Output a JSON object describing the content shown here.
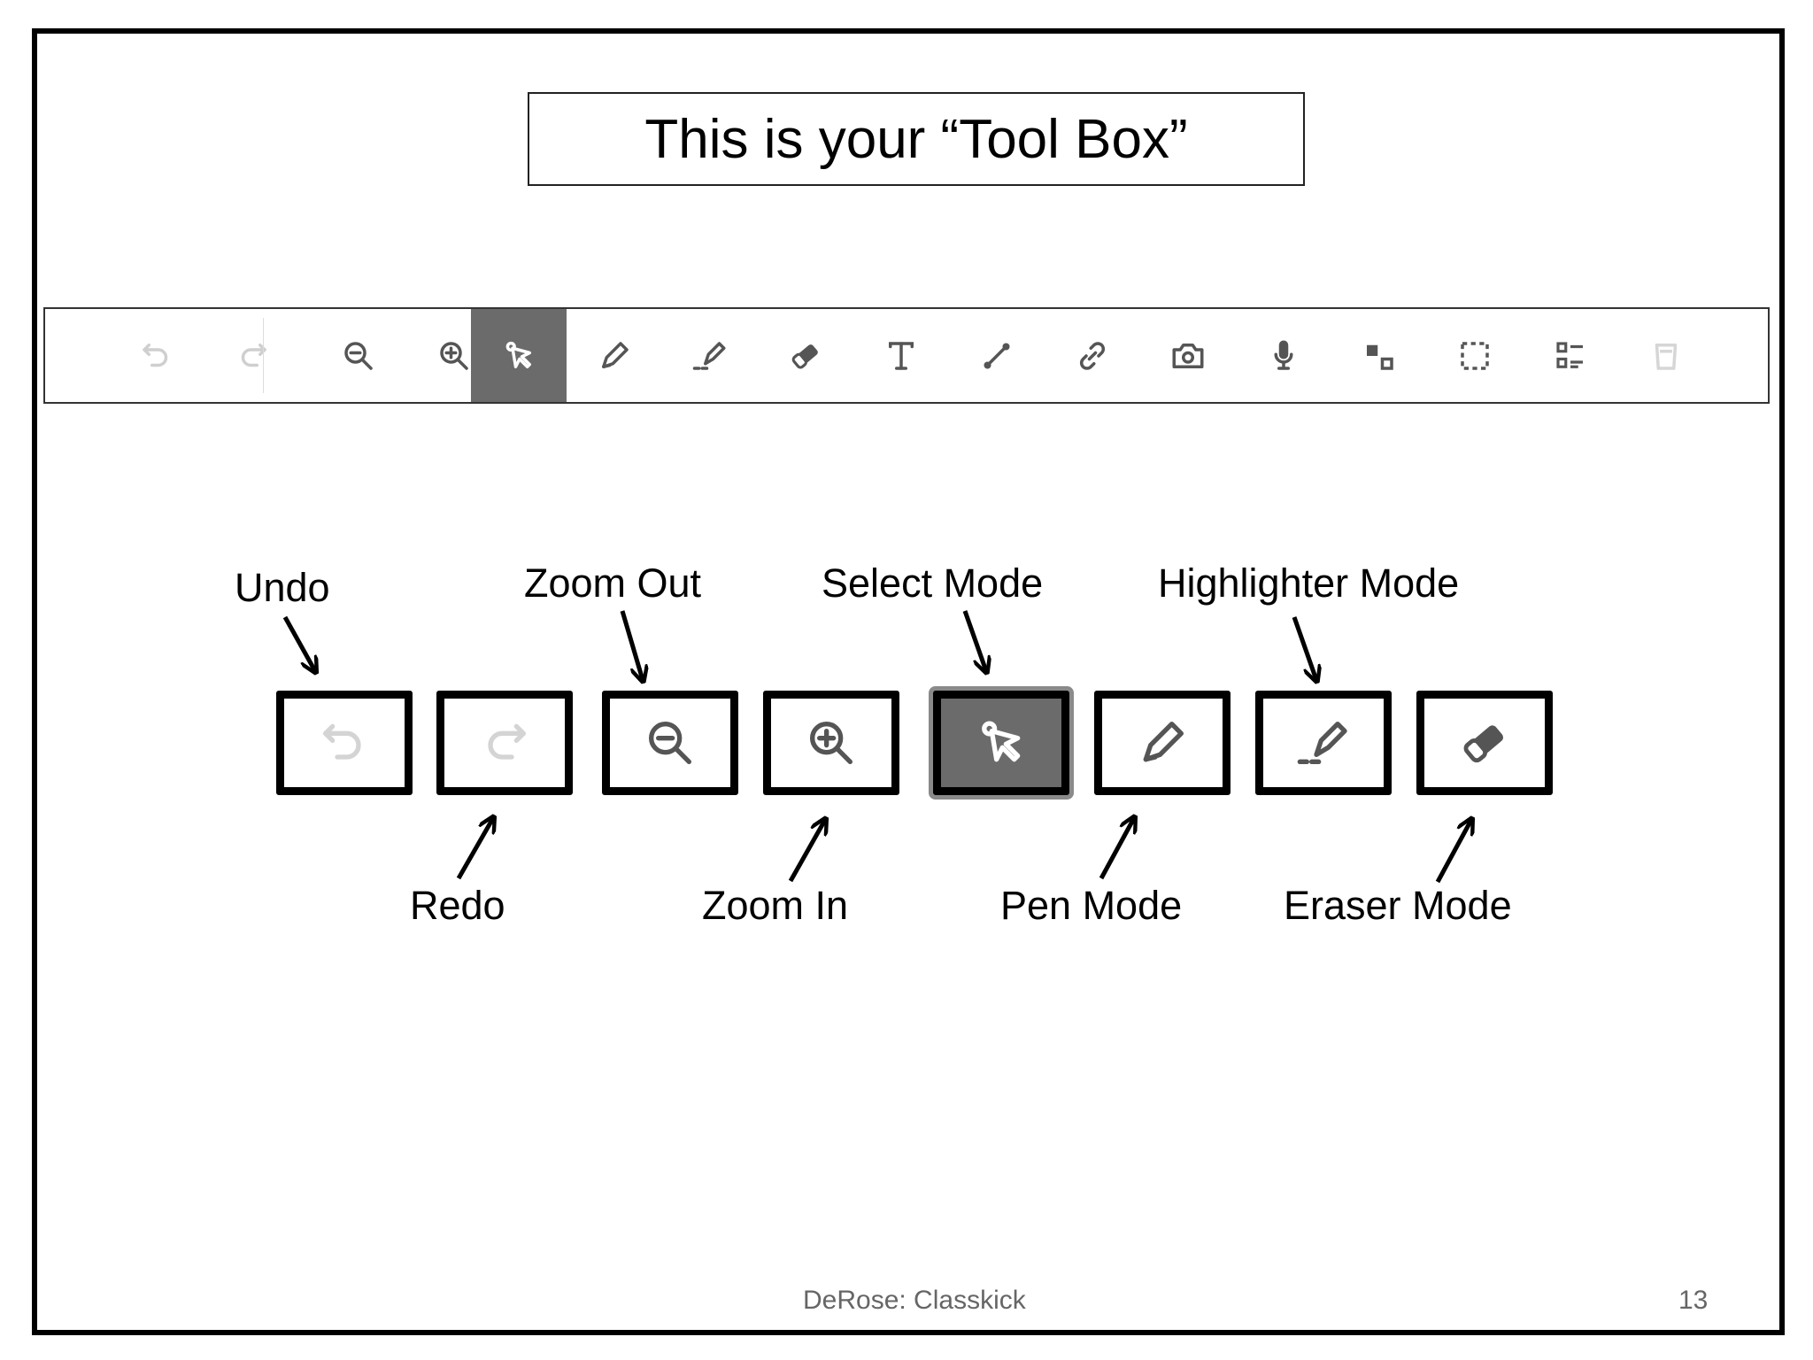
{
  "title": "This is your “Tool Box”",
  "toolbar": {
    "items": [
      {
        "name": "undo-icon",
        "state": "disabled"
      },
      {
        "name": "redo-icon",
        "state": "disabled"
      },
      {
        "name": "zoom-out-icon",
        "state": "enabled"
      },
      {
        "name": "zoom-in-icon",
        "state": "enabled"
      },
      {
        "name": "select-cursor-icon",
        "state": "active"
      },
      {
        "name": "pen-icon",
        "state": "enabled"
      },
      {
        "name": "highlighter-icon",
        "state": "enabled"
      },
      {
        "name": "eraser-icon",
        "state": "enabled"
      },
      {
        "name": "text-icon",
        "state": "enabled"
      },
      {
        "name": "line-icon",
        "state": "enabled"
      },
      {
        "name": "link-icon",
        "state": "enabled"
      },
      {
        "name": "camera-icon",
        "state": "enabled"
      },
      {
        "name": "microphone-icon",
        "state": "enabled"
      },
      {
        "name": "shapes-icon",
        "state": "enabled"
      },
      {
        "name": "dashed-selection-icon",
        "state": "enabled"
      },
      {
        "name": "list-icon",
        "state": "enabled"
      },
      {
        "name": "trash-icon",
        "state": "disabled"
      }
    ]
  },
  "labels": {
    "undo": "Undo",
    "redo": "Redo",
    "zoom_out": "Zoom Out",
    "zoom_in": "Zoom In",
    "select_mode": "Select Mode",
    "pen_mode": "Pen Mode",
    "highlighter_mode": "Highlighter Mode",
    "eraser_mode": "Eraser Mode"
  },
  "footer": {
    "center": "DeRose: Classkick",
    "page_number": "13"
  },
  "colors": {
    "active_bg": "#6b6b6b",
    "icon": "#555555",
    "icon_disabled": "#cfcfcf"
  }
}
